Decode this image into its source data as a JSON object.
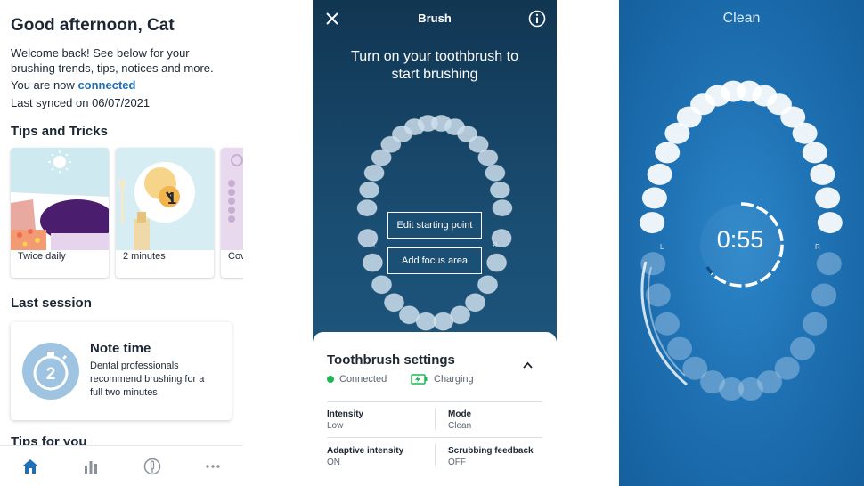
{
  "home": {
    "greeting": "Good afternoon, Cat",
    "welcome_text": "Welcome back! See below for your brushing trends, tips, notices and more.",
    "connection_prefix": "You are now",
    "connection_status": "connected",
    "sync_prefix": "Last synced on",
    "sync_date": "06/07/2021",
    "tips_heading": "Tips and Tricks",
    "tip_cards": [
      {
        "label": "Twice daily"
      },
      {
        "label": "2 minutes"
      },
      {
        "label": "Cov"
      }
    ],
    "last_session_heading": "Last session",
    "note": {
      "title": "Note time",
      "body": "Dental professionals recommend brushing for a full two minutes",
      "icon_number": "2"
    },
    "tips_for_you_heading": "Tips for you",
    "nav": [
      "home-icon",
      "chart-icon",
      "brush-icon",
      "more-icon"
    ]
  },
  "brush": {
    "title": "Brush",
    "prompt": "Turn on your toothbrush to start brushing",
    "edit_button": "Edit starting point",
    "focus_button": "Add focus area",
    "left_label": "L",
    "right_label": "R",
    "settings": {
      "title": "Toothbrush settings",
      "connected": "Connected",
      "charging": "Charging",
      "intensity_label": "Intensity",
      "intensity_value": "Low",
      "mode_label": "Mode",
      "mode_value": "Clean",
      "adaptive_label": "Adaptive intensity",
      "adaptive_value": "ON",
      "scrubbing_label": "Scrubbing feedback",
      "scrubbing_value": "OFF"
    }
  },
  "clean": {
    "title": "Clean",
    "timer": "0:55",
    "left_label": "L",
    "right_label": "R"
  },
  "colors": {
    "link_blue": "#1f6fb5",
    "connected_green": "#1db954",
    "brush_bg": "#1a4d72",
    "clean_bg": "#1f72b4"
  }
}
